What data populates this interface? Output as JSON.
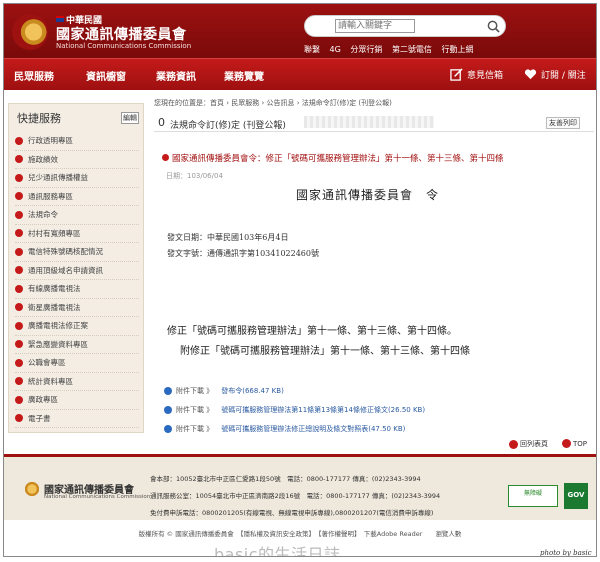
{
  "site": {
    "name_small": "中華民國",
    "name_big": "國家通訊傳播委員會",
    "name_en": "National Communications Commission"
  },
  "search": {
    "placeholder": "請輸入關鍵字",
    "value": "請輸入關鍵字"
  },
  "top_links": [
    "聯繫",
    "4G",
    "分眾行銷",
    "第二號電信",
    "行動上網"
  ],
  "nav": {
    "items": [
      "民眾服務",
      "資訊櫥窗",
      "業務資訊",
      "業務覽覽"
    ],
    "feedback": "意見信箱",
    "subscribe": "訂閱 / 關注"
  },
  "sidebar": {
    "title": "快捷服務",
    "edit": "編輯",
    "items": [
      "行政透明專區",
      "施政績效",
      "兒少通訊傳播權益",
      "通訊服務專區",
      "法規命令",
      "村村有寬頻專區",
      "電信特殊號碼核配情況",
      "通用頂級域名申請資訊",
      "有線廣播電視法",
      "衛星廣播電視法",
      "廣播電視法修正案",
      "緊急應變資料專區",
      "公職會專區",
      "統計資料專區",
      "廣政專區",
      "電子書"
    ]
  },
  "breadcrumb": "您現在的位置是：首頁 › 民眾服務 › 公告訊息 › 法規命令訂(修)定 (刊登公報)",
  "page_header": {
    "num": "0",
    "title": "法規命令訂(修)定 (刊登公報)",
    "print": "友善列印"
  },
  "article": {
    "title": "國家通訊傳播委員會令：修正「號碼可攜服務管理辦法」第十一條、第十三條、第十四條",
    "date_label": "日期：103/06/04",
    "org": "國家通訊傳播委員會　令",
    "issue_date": "發文日期：中華民國103年6月4日",
    "issue_no": "發文字號：通傳通訊字第10341022460號",
    "main1": "修正「號碼可攜服務管理辦法」第十一條、第十三條、第十四條。",
    "main2": "附修正「號碼可攜服務管理辦法」第十一條、第十三條、第十四條"
  },
  "attachments": [
    {
      "label": "附件下載 》",
      "file": "發布令(668.47 KB)"
    },
    {
      "label": "附件下載 》",
      "file": "號碼可攜服務管理辦法第11條第13條第14條修正條文(26.50 KB)"
    },
    {
      "label": "附件下載 》",
      "file": "號碼可攜服務管理辦法修正總說明及條文對照表(47.50 KB)"
    }
  ],
  "page_nav": {
    "back": "回列表頁",
    "top": "TOP"
  },
  "footer": {
    "line1": "會本部：10052臺北市中正區仁愛路1段50號　電話：0800-177177 傳真：(02)2343-3994",
    "line2": "通訊服務公室：10054臺北市中正區濟南路2段16號　電話：0800-177177 傳真：(02)2343-3994",
    "line3": "免付費申訴電話：0800201205(有線電視、無線電視申訴專線),0800201207(電信消費申訴專線)",
    "badge_access": "無障礙",
    "badge_gov": "GOV"
  },
  "copyright": "版權所有 © 國家通訊傳播委員會　【隱私權及資訊安全政策】　【著作權聲明】　下載Adobe Reader　　瀏覽人數",
  "watermark": "basic的生活日誌",
  "photo_credit": "photo by basic"
}
